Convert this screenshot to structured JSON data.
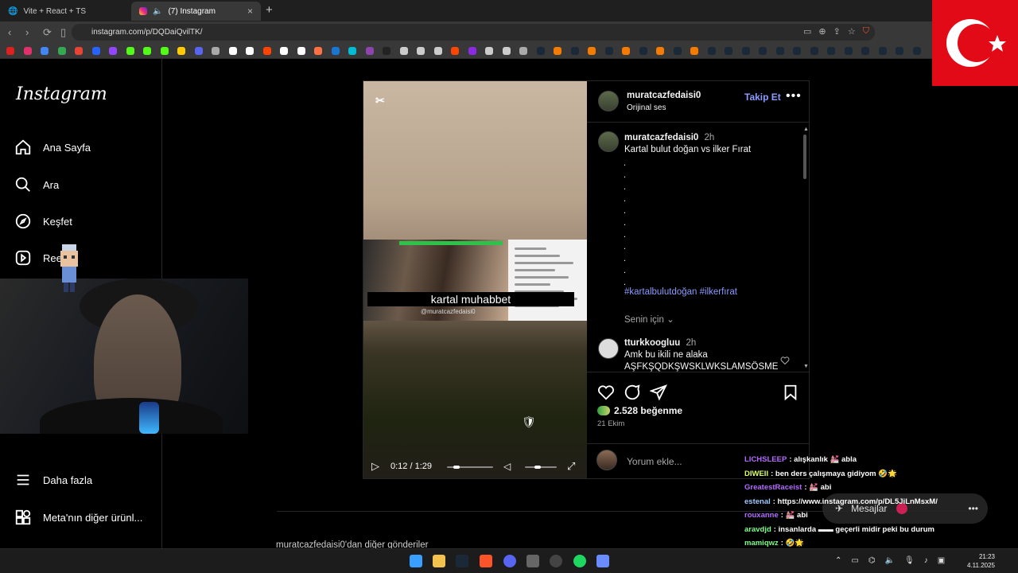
{
  "browser": {
    "tabs": [
      {
        "title": "Vite + React + TS",
        "active": false
      },
      {
        "title": "(7) Instagram",
        "active": true
      }
    ],
    "url": "instagram.com/p/DQDaiQvilTK/"
  },
  "sidebar": {
    "logo": "Instagram",
    "items": [
      {
        "label": "Ana Sayfa",
        "icon": "home-icon"
      },
      {
        "label": "Ara",
        "icon": "search-icon"
      },
      {
        "label": "Keşfet",
        "icon": "compass-icon"
      },
      {
        "label": "Ree",
        "icon": "reels-icon"
      }
    ],
    "more": "Daha fazla",
    "meta": "Meta'nın diğer ürünl..."
  },
  "post": {
    "author": "muratcazfedaisi0",
    "audio": "Orijinal ses",
    "follow": "Takip Et",
    "video": {
      "caption": "kartal muhabbet",
      "watermark": "@muratcazfedaisi0",
      "time": "0:12 / 1:29",
      "progress": 0.13,
      "volume": 0.3
    },
    "description": {
      "author": "muratcazfedaisi0",
      "time": "2h",
      "text": "Kartal bulut doğan vs ilker Fırat",
      "dots": [
        ".",
        ".",
        ".",
        ".",
        ".",
        ".",
        ".",
        ".",
        ".",
        ".",
        "."
      ],
      "hashtags": "#kartalbulutdoğan #ilkerfırat"
    },
    "for_you": "Senin için",
    "comment": {
      "author": "tturkkoogluu",
      "time": "2h",
      "line1": "Amk bu ikili ne alaka",
      "line2": "AŞFKŞQDKŞWSKLWKSLAMSÖSME"
    },
    "likes": "2.528 beğenme",
    "date": "21 Ekim",
    "add_comment_placeholder": "Yorum ekle..."
  },
  "more_posts": "muratcazfedaisi0'dan diğer gönderiler",
  "messages_button": "Mesajlar",
  "stream_chat": [
    {
      "user": "LICHSLEEP",
      "text": ": alışkanlık 💒 abla",
      "color": "#b36bff"
    },
    {
      "user": "DIWEII",
      "text": ": ben ders çalışmaya gidiyom 🤣🌟",
      "color": "#d9ff5e"
    },
    {
      "user": "GreatestRaceist",
      "text": ": 💒 abi",
      "color": "#b36bff"
    },
    {
      "user": "estenal",
      "text": ": https://www.instagram.com/p/DL5JiLnMsxM/",
      "color": "#9ec9ff"
    },
    {
      "user": "rouxanne",
      "text": ": 💒 abi",
      "color": "#b36bff"
    },
    {
      "user": "aravdjd",
      "text": ": insanlarda ▬▬ geçerli midir peki bu durum",
      "color": "#7cff8a"
    },
    {
      "user": "mamiqwz",
      "text": ": 🤣🌟",
      "color": "#7cff8a"
    }
  ],
  "clock": {
    "time": "21:23",
    "date": "4.11.2025"
  },
  "colors": {
    "accent": "#8c9bff",
    "flag": "#e30a17"
  }
}
